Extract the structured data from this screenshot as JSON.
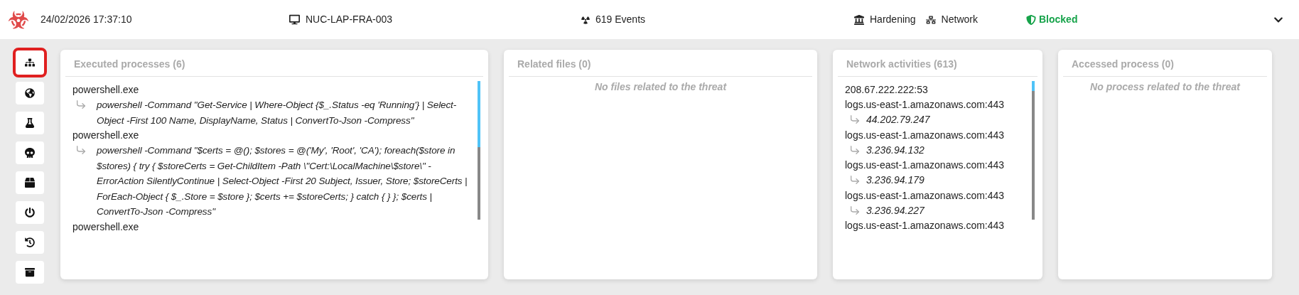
{
  "top_bar": {
    "timestamp": "24/02/2026 17:37:10",
    "host": "NUC-LAP-FRA-003",
    "events": "619 Events",
    "links": [
      "Hardening",
      "Network"
    ],
    "status": {
      "label": "Blocked",
      "kind": "blocked"
    }
  },
  "sidebar": {
    "items": [
      {
        "kind": "tree",
        "selected": true
      },
      {
        "kind": "globe",
        "selected": false
      },
      {
        "kind": "flask",
        "selected": false
      },
      {
        "kind": "skull",
        "selected": false
      },
      {
        "kind": "box",
        "selected": false
      },
      {
        "kind": "power",
        "selected": false
      },
      {
        "kind": "history",
        "selected": false
      },
      {
        "kind": "archive",
        "selected": false
      }
    ]
  },
  "panels": [
    {
      "title": "Executed processes (6)",
      "kind": "processes",
      "items": [
        {
          "name": "powershell.exe",
          "children": [
            "powershell -Command \"Get-Service | Where-Object {$_.Status -eq 'Running'} | Select-Object -First 100 Name, DisplayName, Status | ConvertTo-Json -Compress\""
          ]
        },
        {
          "name": "powershell.exe",
          "children": [
            "powershell -Command \"$certs = @(); $stores = @('My', 'Root', 'CA'); foreach($store in $stores) { try { $storeCerts = Get-ChildItem -Path \\\"Cert:\\LocalMachine\\$store\\\" -ErrorAction SilentlyContinue | Select-Object -First 20 Subject, Issuer, Store; $storeCerts | ForEach-Object { $_.Store = $store }; $certs += $storeCerts; } catch { } }; $certs | ConvertTo-Json -Compress\""
          ]
        },
        {
          "name": "powershell.exe"
        }
      ]
    },
    {
      "title": "Related files (0)",
      "kind": "empty",
      "message": "No files related to the threat"
    },
    {
      "title": "Network activities (613)",
      "kind": "network",
      "items": [
        {
          "name": "208.67.222.222:53"
        },
        {
          "name": "logs.us-east-1.amazonaws.com:443",
          "children": [
            "44.202.79.247"
          ]
        },
        {
          "name": "logs.us-east-1.amazonaws.com:443",
          "children": [
            "3.236.94.132"
          ]
        },
        {
          "name": "logs.us-east-1.amazonaws.com:443",
          "children": [
            "3.236.94.179"
          ]
        },
        {
          "name": "logs.us-east-1.amazonaws.com:443",
          "children": [
            "3.236.94.227"
          ]
        },
        {
          "name": "logs.us-east-1.amazonaws.com:443"
        }
      ]
    },
    {
      "title": "Accessed process (0)",
      "kind": "empty",
      "message": "No process related to the threat"
    }
  ]
}
